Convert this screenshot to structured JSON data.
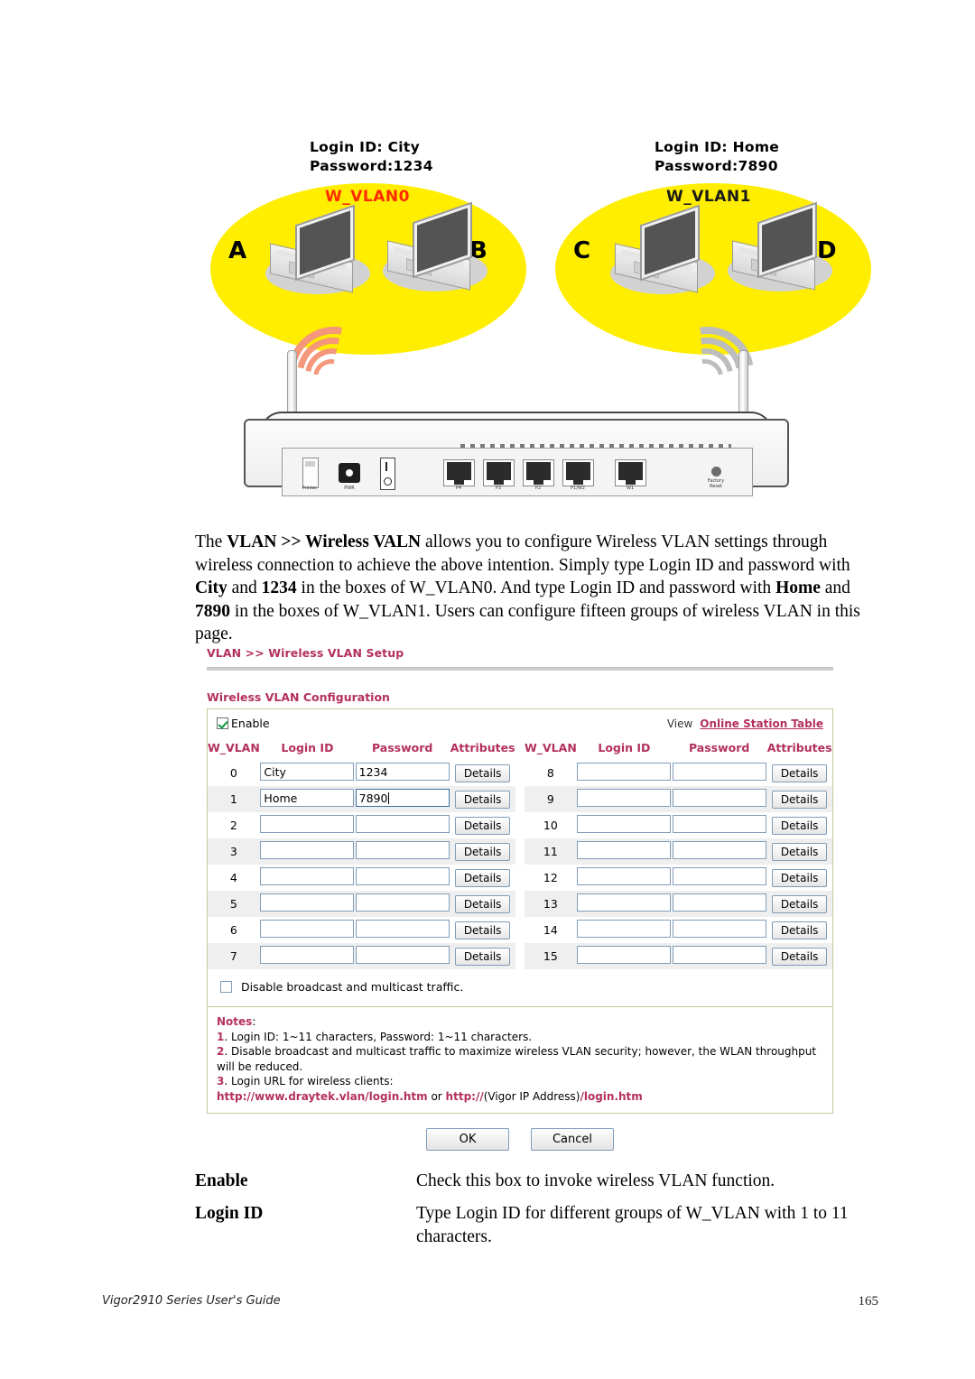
{
  "diagram": {
    "left_caption": "Login ID: City\nPassword:1234",
    "right_caption": "Login ID: Home\nPassword:7890",
    "cloud0_label": "W_VLAN0",
    "cloud1_label": "W_VLAN1",
    "cloud0_color": "#ffee00",
    "cloud1_color": "#ffee00",
    "cloud0_label_color": "#ff2a00",
    "cloud1_label_color": "#1a1a1a",
    "stations": [
      "A",
      "B",
      "C",
      "D"
    ],
    "router": {
      "port_labels": [
        "P4",
        "P3",
        "P2",
        "P1/W2",
        "W1"
      ],
      "usb_label": "Printer",
      "power_label": "PWR",
      "reset_label": "Factory\nReset"
    }
  },
  "paragraph": {
    "part1": "The ",
    "bold1": "VLAN >> Wireless VALN",
    "part2": " allows you to configure Wireless VLAN settings through wireless connection to achieve the above intention. Simply type Login ID and password with ",
    "bold2": "City",
    "part3": " and ",
    "bold3": "1234",
    "part4": " in the boxes of W_VLAN0. And type Login ID and password with ",
    "bold4": "Home",
    "part5": " and ",
    "bold5": "7890",
    "part6": " in the boxes of W_VLAN1. Users can configure fifteen groups of wireless VLAN in this page."
  },
  "ui": {
    "breadcrumb": "VLAN >> Wireless VLAN Setup",
    "section_title": "Wireless VLAN Configuration",
    "enable_label": "Enable",
    "enable_checked": true,
    "view_label": "View",
    "view_link": "Online Station Table",
    "accent_color": "#b3305e",
    "headers": [
      "W_VLAN",
      "Login ID",
      "Password",
      "Attributes",
      "W_VLAN",
      "Login ID",
      "Password",
      "Attributes"
    ],
    "details_label": "Details",
    "rows": [
      {
        "left_id": "0",
        "left_login": "City",
        "left_pass": "1234",
        "left_focus": false,
        "right_id": "8",
        "right_login": "",
        "right_pass": ""
      },
      {
        "left_id": "1",
        "left_login": "Home",
        "left_pass": "7890",
        "left_focus": true,
        "right_id": "9",
        "right_login": "",
        "right_pass": ""
      },
      {
        "left_id": "2",
        "left_login": "",
        "left_pass": "",
        "left_focus": false,
        "right_id": "10",
        "right_login": "",
        "right_pass": ""
      },
      {
        "left_id": "3",
        "left_login": "",
        "left_pass": "",
        "left_focus": false,
        "right_id": "11",
        "right_login": "",
        "right_pass": ""
      },
      {
        "left_id": "4",
        "left_login": "",
        "left_pass": "",
        "left_focus": false,
        "right_id": "12",
        "right_login": "",
        "right_pass": ""
      },
      {
        "left_id": "5",
        "left_login": "",
        "left_pass": "",
        "left_focus": false,
        "right_id": "13",
        "right_login": "",
        "right_pass": ""
      },
      {
        "left_id": "6",
        "left_login": "",
        "left_pass": "",
        "left_focus": false,
        "right_id": "14",
        "right_login": "",
        "right_pass": ""
      },
      {
        "left_id": "7",
        "left_login": "",
        "left_pass": "",
        "left_focus": false,
        "right_id": "15",
        "right_login": "",
        "right_pass": ""
      }
    ],
    "disable_broadcast_label": "Disable broadcast and multicast traffic.",
    "disable_broadcast_checked": false,
    "notes_heading": "Notes",
    "note1_num": "1",
    "note1_text": ". Login ID: 1~11 characters, Password: 1~11 characters.",
    "note2_num": "2",
    "note2_text": ". Disable broadcast and multicast traffic to maximize wireless VLAN security; however, the WLAN throughput will be reduced.",
    "note3_num": "3",
    "note3_text": ". Login URL for wireless clients:",
    "note_url1": "http://www.draytek.vlan/login.htm",
    "note_url_or": "or",
    "note_url2_pre": "http://",
    "note_url2_mid": "(Vigor IP Address)",
    "note_url2_post": "/login.htm",
    "ok_label": "OK",
    "cancel_label": "Cancel"
  },
  "definitions": [
    {
      "term": "Enable",
      "desc": "Check this box to invoke wireless VLAN function."
    },
    {
      "term": "Login ID",
      "desc": "Type Login ID for different groups of W_VLAN with 1 to 11 characters."
    }
  ],
  "footer": {
    "left": "Vigor2910 Series User's Guide",
    "page": "165"
  }
}
